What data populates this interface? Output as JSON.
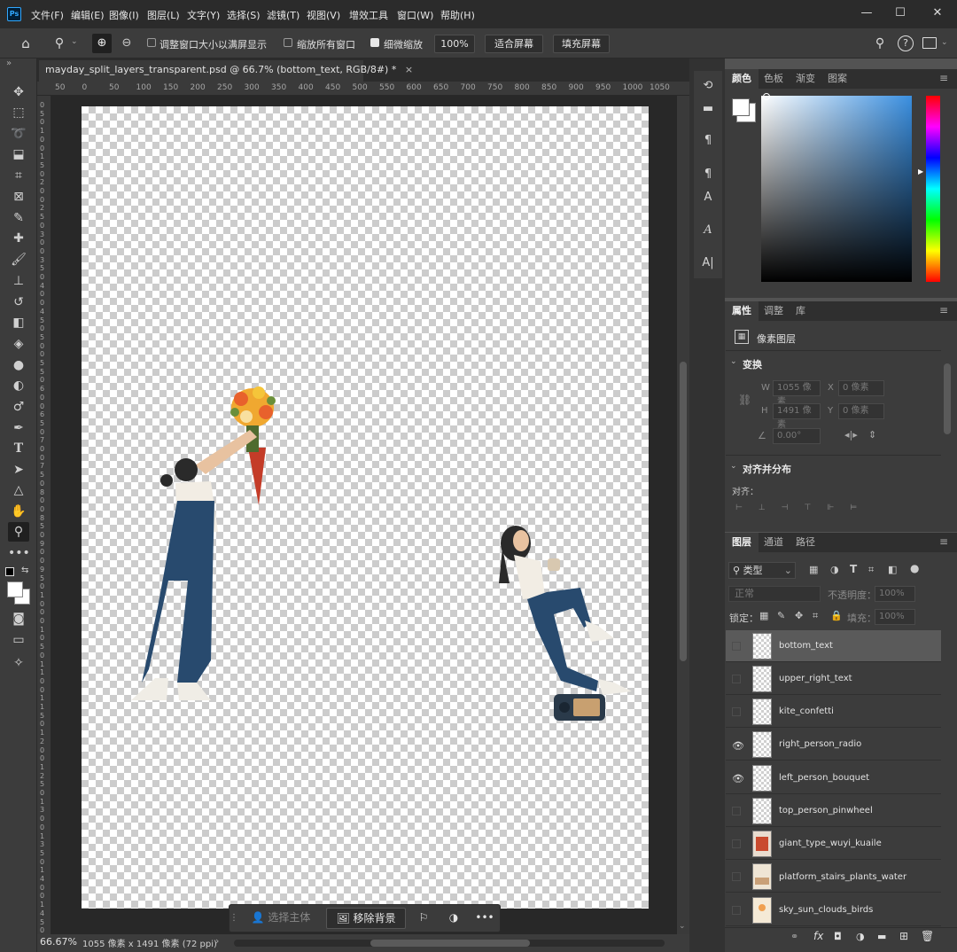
{
  "app": {
    "logo": "Ps"
  },
  "menu": [
    "文件(F)",
    "编辑(E)",
    "图像(I)",
    "图层(L)",
    "文字(Y)",
    "选择(S)",
    "滤镜(T)",
    "视图(V)",
    "增效工具",
    "窗口(W)",
    "帮助(H)"
  ],
  "options": {
    "resize_windows_label": "调整窗口大小以满屏显示",
    "zoom_all_label": "缩放所有窗口",
    "scrubby_zoom_label": "细微缩放",
    "zoom_value": "100%",
    "fit_screen_label": "适合屏幕",
    "fill_screen_label": "填充屏幕"
  },
  "document": {
    "tab_title": "mayday_split_layers_transparent.psd @ 66.7% (bottom_text, RGB/8#) *",
    "close": "×"
  },
  "ruler_h": [
    "50",
    "0",
    "50",
    "100",
    "150",
    "200",
    "250",
    "300",
    "350",
    "400",
    "450",
    "500",
    "550",
    "600",
    "650",
    "700",
    "750",
    "800",
    "850",
    "900",
    "950",
    "1000",
    "1050"
  ],
  "ruler_v": [
    "0",
    "5",
    "0",
    "1",
    "0",
    "0",
    "1",
    "5",
    "0",
    "2",
    "0",
    "0",
    "2",
    "5",
    "0",
    "3",
    "0",
    "0",
    "3",
    "5",
    "0",
    "4",
    "0",
    "0",
    "4",
    "5",
    "0",
    "5",
    "0",
    "0",
    "5",
    "5",
    "0",
    "6",
    "0",
    "0",
    "6",
    "5",
    "0",
    "7",
    "0",
    "0",
    "7",
    "5",
    "0",
    "8",
    "0",
    "0",
    "8",
    "5",
    "0",
    "9",
    "0",
    "0",
    "9",
    "5",
    "0",
    "1",
    "0",
    "0",
    "0",
    "1",
    "0",
    "5",
    "0",
    "1",
    "1",
    "0",
    "0",
    "1",
    "1",
    "5",
    "0",
    "1",
    "2",
    "0",
    "0",
    "1",
    "2",
    "5",
    "0",
    "1",
    "3",
    "0",
    "0",
    "1",
    "3",
    "5",
    "0",
    "1",
    "4",
    "0",
    "0",
    "1",
    "4",
    "5",
    "0"
  ],
  "context_bar": {
    "select_subject": "选择主体",
    "remove_bg": "移除背景"
  },
  "status": {
    "zoom": "66.67%",
    "doc_info": "1055 像素 x 1491 像素 (72 ppi)"
  },
  "color_panel": {
    "tabs": [
      "颜色",
      "色板",
      "渐变",
      "图案"
    ]
  },
  "properties": {
    "tabs": [
      "属性",
      "调整",
      "库"
    ],
    "layer_type": "像素图层",
    "transform_title": "变换",
    "w_label": "W",
    "w_value": "1055 像素",
    "h_label": "H",
    "h_value": "1491 像素",
    "x_label": "X",
    "x_value": "0 像素",
    "y_label": "Y",
    "y_value": "0 像素",
    "angle_value": "0.00°",
    "align_title": "对齐并分布",
    "align_label": "对齐："
  },
  "layers_panel": {
    "tabs": [
      "图层",
      "通道",
      "路径"
    ],
    "filter_label": "类型",
    "blend_mode": "正常",
    "opacity_label": "不透明度：",
    "opacity_value": "100%",
    "lock_label": "锁定：",
    "fill_label": "填充：",
    "fill_value": "100%",
    "layers": [
      {
        "name": "bottom_text",
        "visible": false,
        "selected": true
      },
      {
        "name": "upper_right_text",
        "visible": false,
        "selected": false
      },
      {
        "name": "kite_confetti",
        "visible": false,
        "selected": false
      },
      {
        "name": "right_person_radio",
        "visible": true,
        "selected": false
      },
      {
        "name": "left_person_bouquet",
        "visible": true,
        "selected": false
      },
      {
        "name": "top_person_pinwheel",
        "visible": false,
        "selected": false
      },
      {
        "name": "giant_type_wuyi_kuaile",
        "visible": false,
        "selected": false
      },
      {
        "name": "platform_stairs_plants_water",
        "visible": false,
        "selected": false
      },
      {
        "name": "sky_sun_clouds_birds",
        "visible": false,
        "selected": false
      }
    ]
  },
  "colors": {
    "accent_blue": "#31a8ff",
    "panel_bg": "#3c3c3c",
    "selected_layer": "#5a5a5a"
  }
}
